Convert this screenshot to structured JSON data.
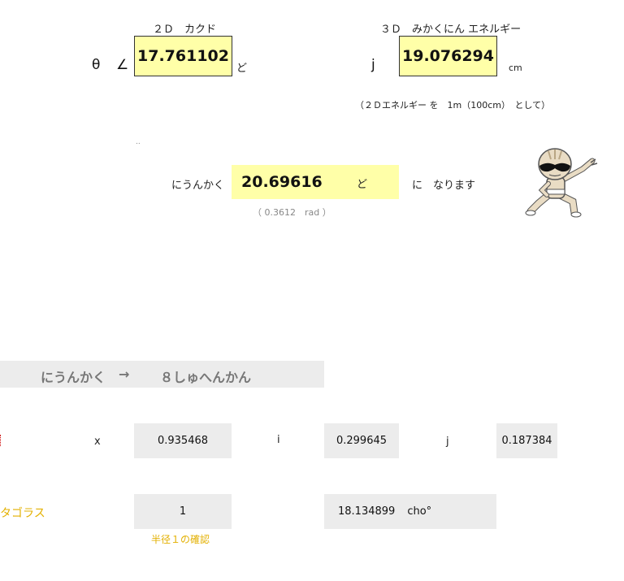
{
  "top_left": {
    "label": "２Ｄ　カクド",
    "theta_symbol": "θ",
    "angle_symbol": "∠",
    "value": "17.761102",
    "unit": "ど"
  },
  "top_right": {
    "label": "３Ｄ　みかくにん エネルギー",
    "symbol": "j",
    "value": "19.076294",
    "unit": "cm",
    "note": "（２Ｄエネルギー を　1m（100cm）　として）"
  },
  "tiny_mark": "..",
  "incidence": {
    "label": "にうんかく",
    "value": "20.69616",
    "unit": "ど",
    "suffix": "に　なります",
    "rad_note": "（ 0.3612　rad ）"
  },
  "banner": {
    "left": "にうんかく",
    "arrow": "→",
    "right": "８しゅへんかん"
  },
  "vector_row": {
    "x_label": "x",
    "x_value": "0.935468",
    "i_label": "i",
    "i_value": "0.299645",
    "j_label": "j",
    "j_value": "0.187384"
  },
  "pythagoras_row": {
    "label": "タゴラス",
    "value_1": "1",
    "value_2": "18.134899",
    "value_2_unit": "cho°",
    "check_note": "半径１の確認"
  },
  "colors": {
    "yellow": "#ffffa8",
    "gray": "#ececec",
    "gold": "#e3b000"
  }
}
